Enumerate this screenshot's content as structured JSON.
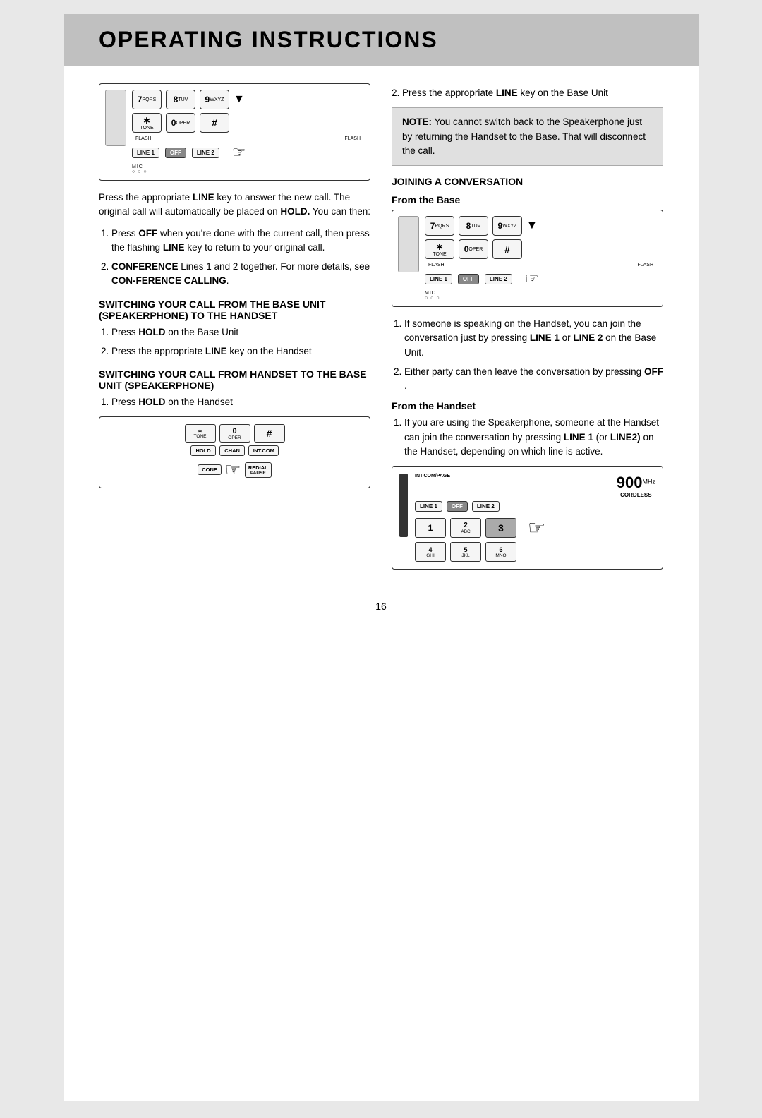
{
  "page": {
    "title": "OPERATING INSTRUCTIONS",
    "page_number": "16"
  },
  "left_col": {
    "intro_text": "Press the appropriate LINE key to answer the new call.  The original call will automatically be placed on HOLD. You can then:",
    "items": [
      {
        "label": "1.",
        "text_parts": [
          {
            "text": "Press ",
            "bold": false
          },
          {
            "text": "OFF",
            "bold": true
          },
          {
            "text": " when you’re done with the current call, then press the flashing ",
            "bold": false
          },
          {
            "text": "LINE",
            "bold": true
          },
          {
            "text": " key to return to your original call.",
            "bold": false
          }
        ]
      },
      {
        "label": "2.",
        "text_parts": [
          {
            "text": "CONFERENCE",
            "bold": true
          },
          {
            "text": " Lines 1 and 2 together. For more details, see ",
            "bold": false
          },
          {
            "text": "CON-FERENCE CALLING",
            "bold": true
          },
          {
            "text": ".",
            "bold": false
          }
        ]
      }
    ],
    "switch_heading1": "SWITCHING YOUR CALL FROM THE BASE UNIT (SPEAKERPHONE) TO THE HANDSET",
    "switch_steps1": [
      {
        "label": "1.",
        "text_parts": [
          {
            "text": "Press ",
            "bold": false
          },
          {
            "text": "HOLD",
            "bold": true
          },
          {
            "text": " on the Base Unit",
            "bold": false
          }
        ]
      },
      {
        "label": "2.",
        "text_parts": [
          {
            "text": "Press the appropriate ",
            "bold": false
          },
          {
            "text": "LINE",
            "bold": true
          },
          {
            "text": " key on the Handset",
            "bold": false
          }
        ]
      }
    ],
    "switch_heading2": "SWITCHING YOUR CALL FROM HANDSET TO THE BASE UNIT (SPEAKERPHONE)",
    "switch_steps2": [
      {
        "label": "1.",
        "text_parts": [
          {
            "text": "Press ",
            "bold": false
          },
          {
            "text": "HOLD",
            "bold": true
          },
          {
            "text": " on the Handset",
            "bold": false
          }
        ]
      }
    ]
  },
  "right_col": {
    "step2_text_parts": [
      {
        "text": "Press the appropriate ",
        "bold": false
      },
      {
        "text": "LINE",
        "bold": true
      },
      {
        "text": " key on the Base Unit",
        "bold": false
      }
    ],
    "note_heading": "NOTE:",
    "note_text": " You cannot switch back to the Speakerphone just by returning the Handset  to the Base. That will disconnect the call.",
    "joining_heading": "JOINING A CONVERSATION",
    "from_base_heading": "From the Base",
    "joining_steps1": [
      {
        "label": "1.",
        "text_parts": [
          {
            "text": "If someone is speaking on the Handset, you can join the conversation just by pressing ",
            "bold": false
          },
          {
            "text": "LINE 1",
            "bold": true
          },
          {
            "text": " or ",
            "bold": false
          },
          {
            "text": "LINE 2",
            "bold": true
          },
          {
            "text": " on the Base Unit.",
            "bold": false
          }
        ]
      },
      {
        "label": "2.",
        "text_parts": [
          {
            "text": "Either party can then leave the conversation by pressing ",
            "bold": false
          },
          {
            "text": "OFF",
            "bold": true
          },
          {
            "text": " .",
            "bold": false
          }
        ]
      }
    ],
    "from_handset_heading": "From the Handset",
    "joining_steps2": [
      {
        "label": "1.",
        "text_parts": [
          {
            "text": "If you are using the Speakerphone, someone at the Handset can join the conversation by pressing ",
            "bold": false
          },
          {
            "text": "LINE 1",
            "bold": true
          },
          {
            "text": " (or ",
            "bold": false
          },
          {
            "text": "LINE2)",
            "bold": true
          },
          {
            "text": " on the Handset, depending on which line is active.",
            "bold": false
          }
        ]
      }
    ]
  },
  "diagrams": {
    "phone_keys": {
      "row1": [
        "7PQRS",
        "8TUV",
        "9WXYZ"
      ],
      "row2": [
        "*TONE",
        "0OPER",
        "#"
      ],
      "flash1": "FLASH",
      "flash2": "FLASH",
      "line1": "LINE 1",
      "off": "OFF",
      "line2": "LINE 2",
      "mic": "MIC"
    },
    "handset": {
      "top_row": [
        "*TONE",
        "0OPER",
        "#"
      ],
      "btns": [
        "HOLD",
        "CHAN",
        "INT.COM"
      ],
      "conf": "CONF",
      "redial": "REDIAL",
      "pause": "PAUSE"
    },
    "base_cordless": {
      "int_com_page": "INT.COM/PAGE",
      "frequency": "900",
      "mhz": "MHz",
      "cordless": "CORDLESS",
      "line1": "LINE 1",
      "off": "OFF",
      "line2": "LINE 2",
      "num_row1": [
        "1",
        "2ABC",
        "3"
      ],
      "num_row2": [
        "4GHI",
        "5JKL",
        "6MNO"
      ]
    }
  }
}
